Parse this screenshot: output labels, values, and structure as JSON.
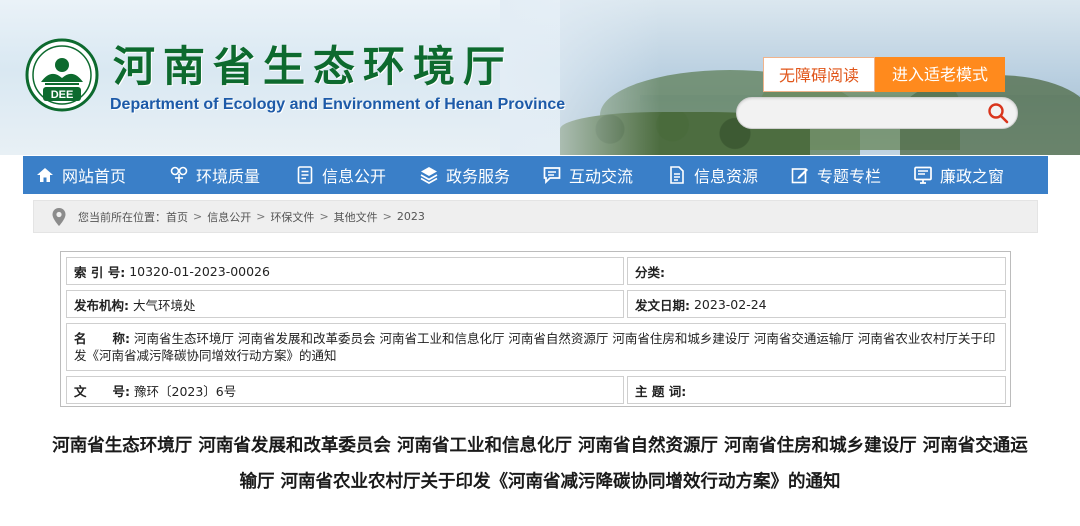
{
  "header": {
    "title": "河南省生态环境厅",
    "subtitle": "Department of Ecology and Environment of Henan Province",
    "logo_text": "DEE",
    "accessibility_label": "无障碍阅读",
    "elderly_mode_label": "进入适老模式",
    "search": {
      "placeholder": ""
    }
  },
  "nav": {
    "items": [
      {
        "label": "网站首页",
        "icon": "home-icon"
      },
      {
        "label": "环境质量",
        "icon": "environment-icon"
      },
      {
        "label": "信息公开",
        "icon": "document-icon"
      },
      {
        "label": "政务服务",
        "icon": "layers-icon"
      },
      {
        "label": "互动交流",
        "icon": "chat-icon"
      },
      {
        "label": "信息资源",
        "icon": "file-icon"
      },
      {
        "label": "专题专栏",
        "icon": "edit-icon"
      },
      {
        "label": "廉政之窗",
        "icon": "monitor-icon"
      }
    ]
  },
  "breadcrumb": {
    "prefix": "您当前所在位置：",
    "items": [
      "首页",
      "信息公开",
      "环保文件",
      "其他文件",
      "2023"
    ],
    "separator": ">"
  },
  "meta": {
    "index_label": "索 引 号:",
    "index_value": "10320-01-2023-00026",
    "category_label": "分类:",
    "category_value": "",
    "publisher_label": "发布机构:",
    "publisher_value": "大气环境处",
    "date_label": "发文日期:",
    "date_value": "2023-02-24",
    "name_label_1": "名",
    "name_label_2": "称:",
    "name_value": "河南省生态环境厅 河南省发展和改革委员会 河南省工业和信息化厅 河南省自然资源厅 河南省住房和城乡建设厅 河南省交通运输厅 河南省农业农村厅关于印发《河南省减污降碳协同增效行动方案》的通知",
    "docno_label_1": "文",
    "docno_label_2": "号:",
    "docno_value": "豫环〔2023〕6号",
    "subject_label": "主 题 词:",
    "subject_value": ""
  },
  "document": {
    "title": "河南省生态环境厅 河南省发展和改革委员会 河南省工业和信息化厅 河南省自然资源厅 河南省住房和城乡建设厅 河南省交通运输厅 河南省农业农村厅关于印发《河南省减污降碳协同增效行动方案》的通知"
  },
  "colors": {
    "nav_bg": "#3a7fc8",
    "title_green": "#0d6a2e",
    "subtitle_blue": "#1d5aa8",
    "accent_orange": "#ff8a1d"
  }
}
